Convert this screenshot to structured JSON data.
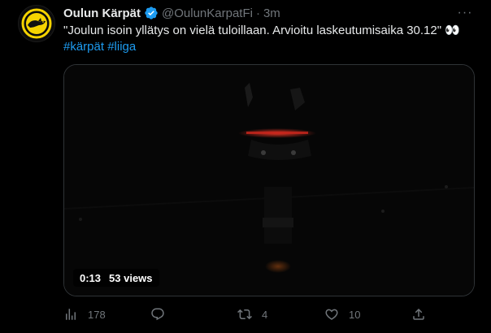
{
  "account": {
    "display_name": "Oulun Kärpät",
    "handle": "@OulunKarpatFi",
    "separator": "·",
    "timestamp": "3m",
    "verified": true,
    "avatar_icon": "karpat-logo-icon"
  },
  "tweet": {
    "text": "\"Joulun isoin yllätys on vielä tuloillaan. Arvioitu laskeutumisaika 30.12\" 👀",
    "hashtags": [
      "#kärpät",
      "#liiga"
    ]
  },
  "media": {
    "type": "video",
    "duration": "0:13",
    "views": "53 views"
  },
  "actions": {
    "analytics_count": "178",
    "reply_count": "",
    "retweet_count": "4",
    "like_count": "10"
  },
  "colors": {
    "background": "#000000",
    "text_primary": "#e7e9ea",
    "text_secondary": "#71767b",
    "accent": "#1d9bf0",
    "border": "#2f3336",
    "logo_yellow": "#f5d300"
  }
}
